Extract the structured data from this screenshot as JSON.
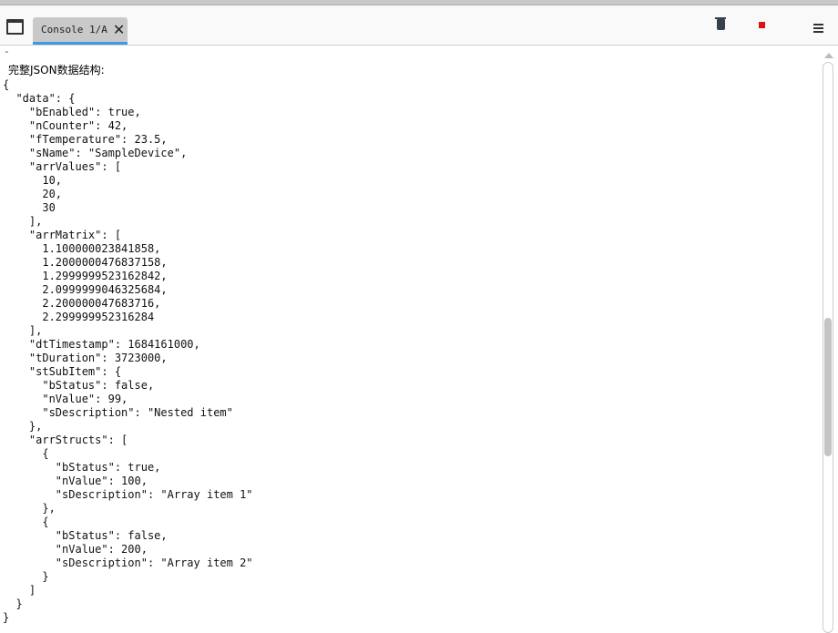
{
  "toolbar": {
    "tab_label": "Console 1/A",
    "close_glyph": "✕",
    "icons": [
      "window-icon",
      "trash-icon",
      "stop-icon",
      "menu-icon"
    ],
    "stop_color": "#d7141a",
    "tab_accent": "#3b9ae1"
  },
  "console": {
    "dash": "-",
    "heading": "完整JSON数据结构:",
    "output": "{\n  \"data\": {\n    \"bEnabled\": true,\n    \"nCounter\": 42,\n    \"fTemperature\": 23.5,\n    \"sName\": \"SampleDevice\",\n    \"arrValues\": [\n      10,\n      20,\n      30\n    ],\n    \"arrMatrix\": [\n      1.100000023841858,\n      1.2000000476837158,\n      1.2999999523162842,\n      2.0999999046325684,\n      2.200000047683716,\n      2.299999952316284\n    ],\n    \"dtTimestamp\": 1684161000,\n    \"tDuration\": 3723000,\n    \"stSubItem\": {\n      \"bStatus\": false,\n      \"nValue\": 99,\n      \"sDescription\": \"Nested item\"\n    },\n    \"arrStructs\": [\n      {\n        \"bStatus\": true,\n        \"nValue\": 100,\n        \"sDescription\": \"Array item 1\"\n      },\n      {\n        \"bStatus\": false,\n        \"nValue\": 200,\n        \"sDescription\": \"Array item 2\"\n      }\n    ]\n  }\n}"
  },
  "scrollbar": {
    "position_fraction": 0.55
  }
}
